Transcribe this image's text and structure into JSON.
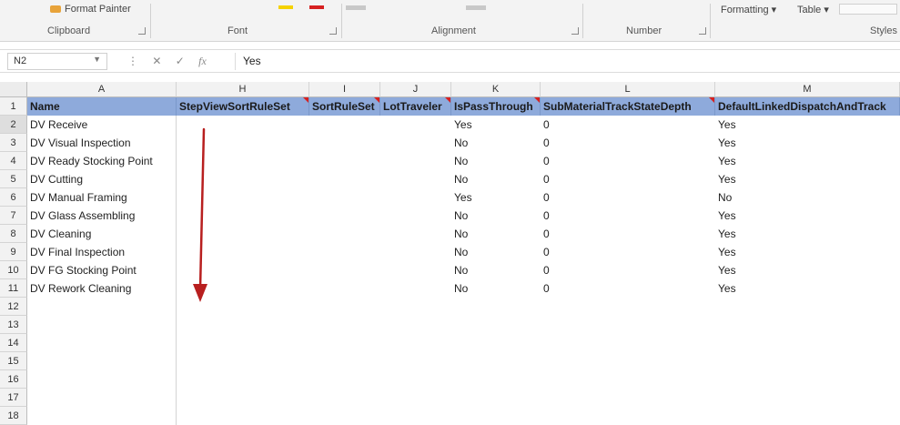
{
  "ribbon": {
    "top_items": {
      "format_painter": "Format Painter",
      "formatting": "Formatting",
      "table": "Table"
    },
    "groups": [
      "Clipboard",
      "Font",
      "Alignment",
      "Number",
      "Styles"
    ]
  },
  "formula_bar": {
    "name_box": "N2",
    "fx_label": "fx",
    "value": "Yes"
  },
  "grid": {
    "columns": [
      "A",
      "H",
      "I",
      "J",
      "K",
      "L",
      "M"
    ],
    "header_row": [
      "Name",
      "StepViewSortRuleSet",
      "SortRuleSet",
      "LotTraveler",
      "IsPassThrough",
      "SubMaterialTrackStateDepth",
      "DefaultLinkedDispatchAndTrack"
    ],
    "row_numbers": [
      "1",
      "2",
      "3",
      "4",
      "5",
      "6",
      "7",
      "8",
      "9",
      "10",
      "11",
      "12",
      "13",
      "14",
      "15",
      "16",
      "17",
      "18"
    ],
    "rows": [
      {
        "name": "DV Receive",
        "pass": "Yes",
        "depth": "0",
        "linked": "Yes"
      },
      {
        "name": "DV Visual Inspection",
        "pass": "No",
        "depth": "0",
        "linked": "Yes"
      },
      {
        "name": "DV Ready Stocking Point",
        "pass": "No",
        "depth": "0",
        "linked": "Yes"
      },
      {
        "name": "DV Cutting",
        "pass": "No",
        "depth": "0",
        "linked": "Yes"
      },
      {
        "name": "DV Manual Framing",
        "pass": "Yes",
        "depth": "0",
        "linked": "No"
      },
      {
        "name": "DV Glass Assembling",
        "pass": "No",
        "depth": "0",
        "linked": "Yes"
      },
      {
        "name": "DV Cleaning",
        "pass": "No",
        "depth": "0",
        "linked": "Yes"
      },
      {
        "name": "DV Final Inspection",
        "pass": "No",
        "depth": "0",
        "linked": "Yes"
      },
      {
        "name": "DV FG Stocking Point",
        "pass": "No",
        "depth": "0",
        "linked": "Yes"
      },
      {
        "name": "DV Rework Cleaning",
        "pass": "No",
        "depth": "0",
        "linked": "Yes"
      }
    ]
  },
  "colors": {
    "header_fill": "#8eaadb",
    "arrow": "#b81f1f"
  }
}
